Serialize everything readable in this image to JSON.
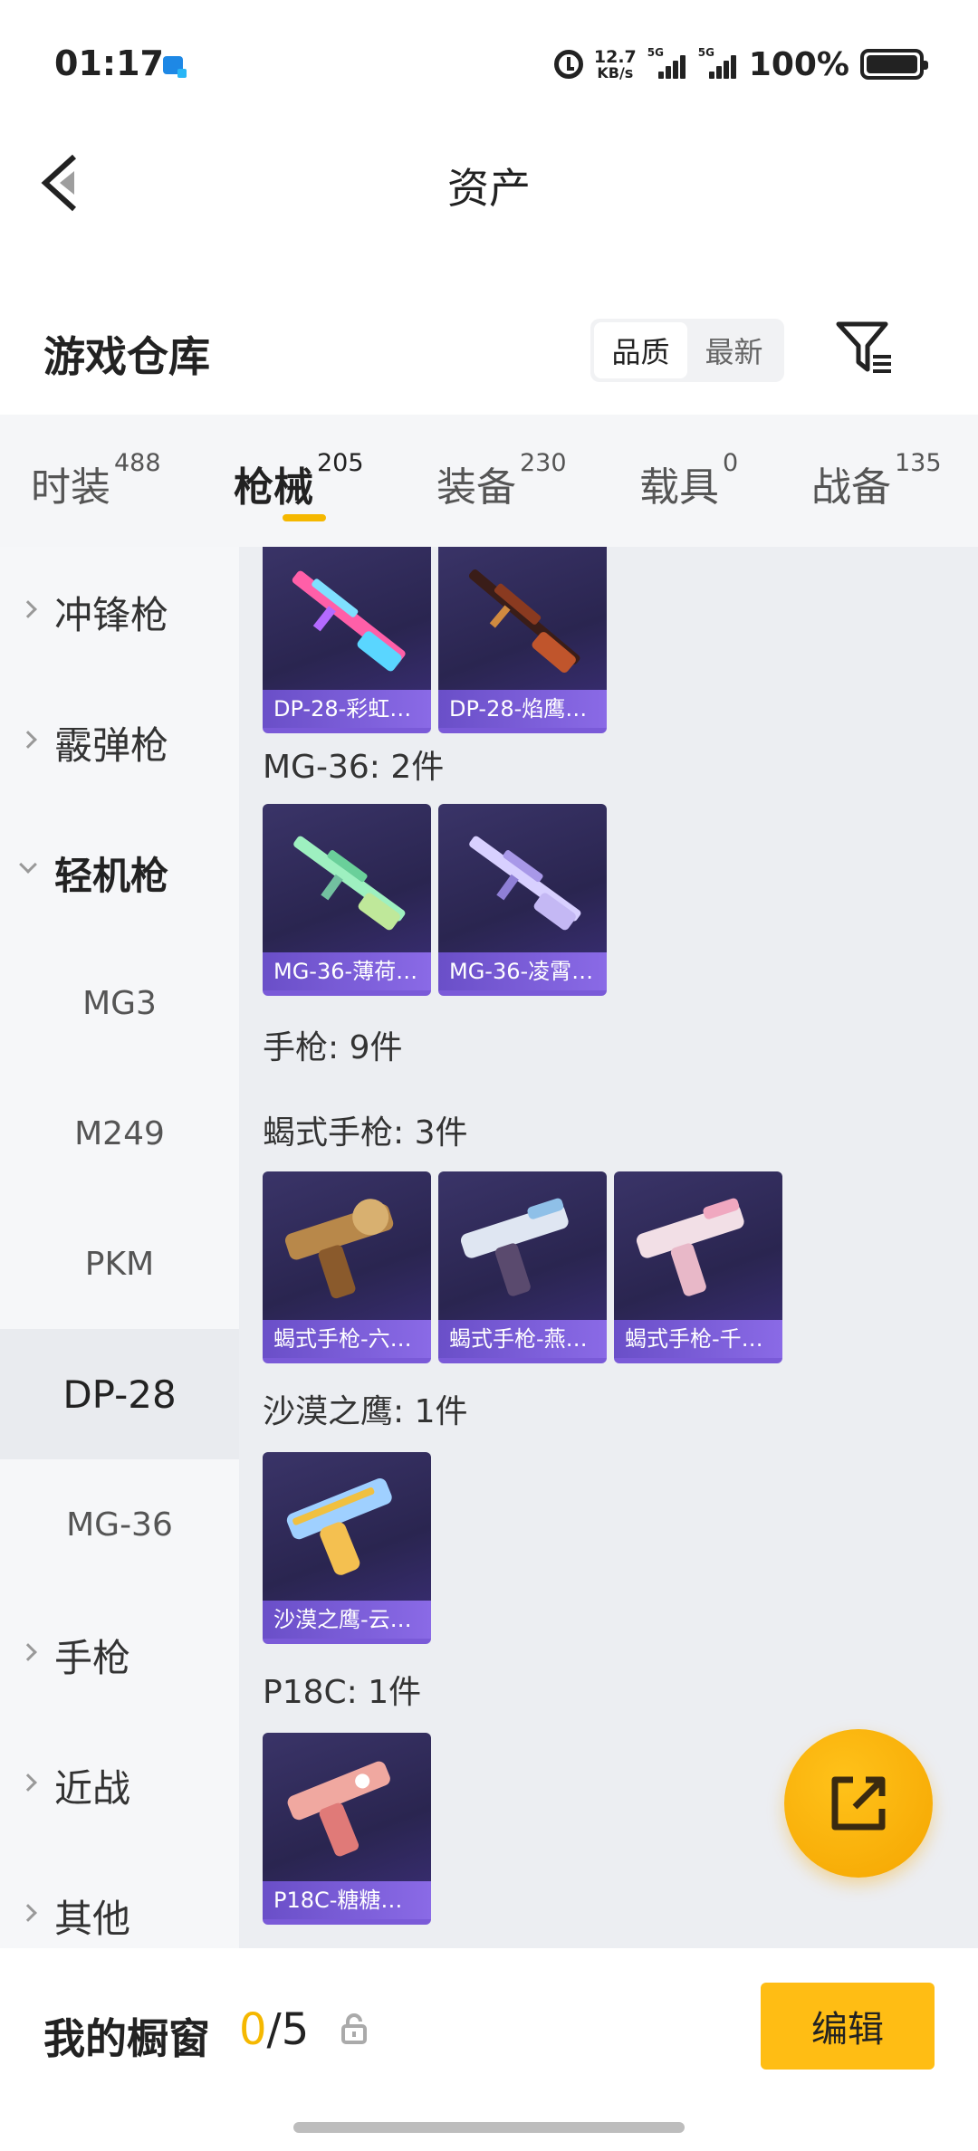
{
  "status_bar": {
    "time": "01:17",
    "net_speed_value": "12.7",
    "net_speed_unit": "KB/s",
    "signal1_label": "5G",
    "signal2_label": "5G",
    "battery_percent": "100%"
  },
  "header": {
    "title": "资产"
  },
  "section": {
    "title": "游戏仓库",
    "sort_options": [
      "品质",
      "最新"
    ],
    "active_sort": "品质"
  },
  "tabs": [
    {
      "label": "时装",
      "count": "488"
    },
    {
      "label": "枪械",
      "count": "205"
    },
    {
      "label": "装备",
      "count": "230"
    },
    {
      "label": "载具",
      "count": "0"
    },
    {
      "label": "战备",
      "count": "135"
    }
  ],
  "active_tab": "枪械",
  "sidebar": {
    "categories": [
      {
        "label": "冲锋枪"
      },
      {
        "label": "霰弹枪"
      },
      {
        "label": "轻机枪"
      },
      {
        "label": "手枪"
      },
      {
        "label": "近战"
      },
      {
        "label": "其他"
      }
    ],
    "subitems": [
      {
        "label": "MG3"
      },
      {
        "label": "M249"
      },
      {
        "label": "PKM"
      },
      {
        "label": "DP-28"
      },
      {
        "label": "MG-36"
      }
    ],
    "active_subitem": "DP-28"
  },
  "content": {
    "groups": [
      {
        "label": "",
        "items": [
          "DP-28-彩虹…",
          "DP-28-焰鹰…"
        ]
      },
      {
        "label": "MG-36: 2件",
        "items": [
          "MG-36-薄荷…",
          "MG-36-凌霄…"
        ]
      },
      {
        "label": "手枪: 9件",
        "items": []
      },
      {
        "label": "蝎式手枪: 3件",
        "items": [
          "蝎式手枪-六…",
          "蝎式手枪-燕…",
          "蝎式手枪-千…"
        ]
      },
      {
        "label": "沙漠之鹰: 1件",
        "items": [
          "沙漠之鹰-云…"
        ]
      },
      {
        "label": "P18C: 1件",
        "items": [
          "P18C-糖糖…"
        ]
      }
    ]
  },
  "bottom_bar": {
    "label": "我的橱窗",
    "count_current": "0",
    "count_total": "/5",
    "edit_label": "编辑"
  },
  "colors": {
    "accent": "#f5b800",
    "card_bg": "#2a2550",
    "card_label": "#7a5ad8"
  }
}
